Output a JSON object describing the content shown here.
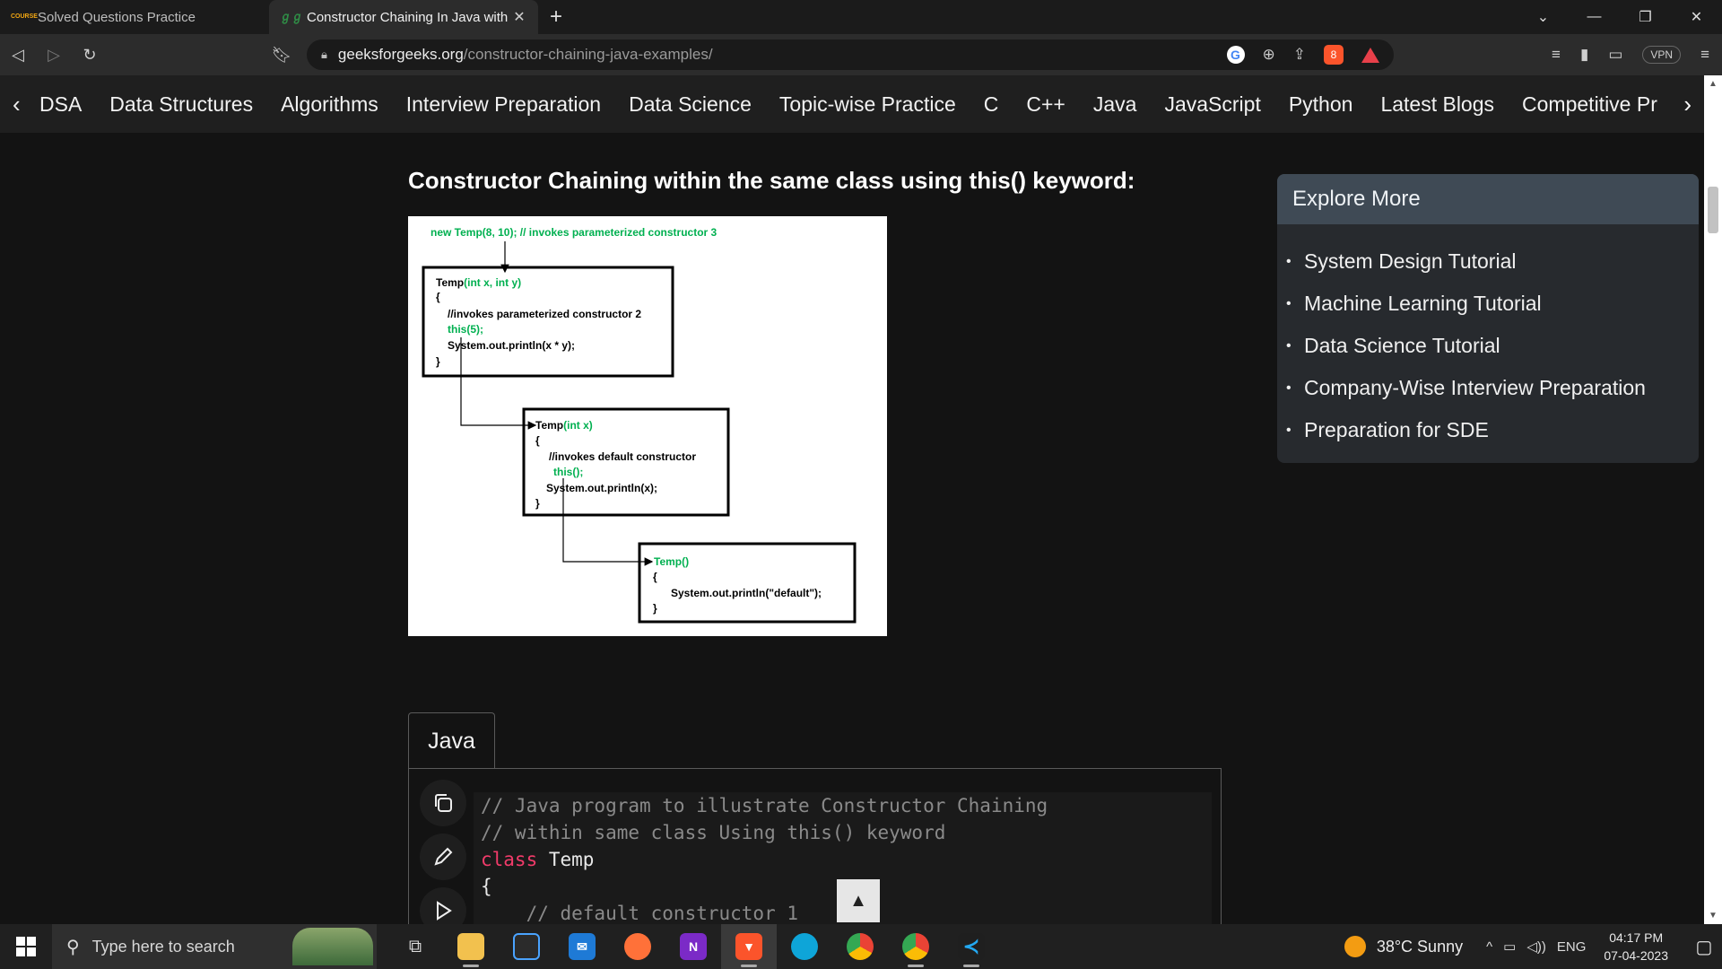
{
  "browser": {
    "tabs": [
      {
        "favicon": "coursera-style-logo",
        "favicon_text": "COURSE",
        "title": "Solved Questions Practice",
        "active": false
      },
      {
        "favicon": "gfg-logo",
        "favicon_text": "ℊℊ",
        "title": "Constructor Chaining In Java with E",
        "active": true
      }
    ],
    "new_tab_label": "+",
    "address": {
      "host": "geeksforgeeks.org",
      "path": "/constructor-chaining-java-examples/"
    },
    "extension_badge": "8",
    "vpn_label": "VPN"
  },
  "site_nav": {
    "items": [
      "DSA",
      "Data Structures",
      "Algorithms",
      "Interview Preparation",
      "Data Science",
      "Topic-wise Practice",
      "C",
      "C++",
      "Java",
      "JavaScript",
      "Python",
      "Latest Blogs",
      "Competitive Pr"
    ]
  },
  "article": {
    "heading": "Constructor Chaining within the same class using this() keyword:",
    "diagram": {
      "top_call": "new Temp(8, 10);  // invokes parameterized constructor 3",
      "box1": {
        "sig_name": "Temp",
        "sig_params": "(int x, int y)",
        "open": "{",
        "comment": "//invokes parameterized constructor 2",
        "call": "this(5);",
        "print": "System.out.println(x * y);",
        "close": "}"
      },
      "box2": {
        "sig_name": "Temp",
        "sig_params": "(int x)",
        "open": "{",
        "comment": "//invokes default constructor",
        "call": "this();",
        "print": "System.out.println(x);",
        "close": "}"
      },
      "box3": {
        "sig": "Temp()",
        "open": "{",
        "print": "System.out.println(\"default\");",
        "close": "}"
      }
    },
    "code_tab": "Java",
    "code_lines": [
      {
        "type": "comment",
        "text": "// Java program to illustrate Constructor Chaining"
      },
      {
        "type": "comment",
        "text": "// within same class Using this() keyword"
      },
      {
        "type": "decl",
        "kw": "class",
        "rest": " Temp"
      },
      {
        "type": "plain",
        "text": "{"
      },
      {
        "type": "comment",
        "text": "    // default constructor 1"
      }
    ],
    "scroll_top_label": "▲"
  },
  "sidebar": {
    "title": "Explore More",
    "links": [
      "System Design Tutorial",
      "Machine Learning Tutorial",
      "Data Science Tutorial",
      "Company-Wise Interview Preparation",
      "Preparation for SDE"
    ]
  },
  "taskbar": {
    "search_placeholder": "Type here to search",
    "weather": "38°C  Sunny",
    "language": "ENG",
    "time": "04:17 PM",
    "date": "07-04-2023"
  },
  "colors": {
    "diagram_green": "#00b050",
    "keyword_pink": "#f23b6a",
    "sidebar_header": "#3f4a55"
  }
}
